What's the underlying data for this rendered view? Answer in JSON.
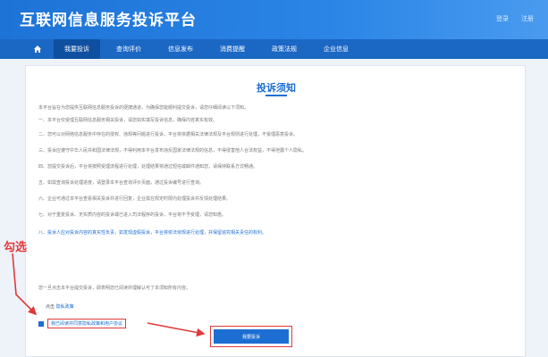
{
  "header": {
    "title": "互联网信息服务投诉平台",
    "links": [
      "登录",
      "注册"
    ]
  },
  "nav": {
    "items": [
      "我要投诉",
      "查询评价",
      "信息发布",
      "消费提醒",
      "政策法规",
      "企业信息"
    ],
    "active": 0
  },
  "notice": {
    "title": "投诉须知",
    "paragraphs": [
      "本平台旨在为您提供互联网信息服务投诉的便捷通道，为确保您能顺利提交投诉，请您仔细阅读以下须知。",
      "一、本平台仅受理互联网信息服务相关投诉，请您如实填写投诉信息，确保内容真实有效。",
      "二、您可以对网络信息服务中存在的侵权、违规等问题进行投诉，平台将依据相关法律法规及平台规则进行处理，不受理恶意投诉。",
      "三、投诉应遵守中华人民共和国法律法规，不得利用本平台发布违反国家法律法规的信息，不得侵害他人合法权益，不得泄露个人隐私。",
      "四、您提交投诉后，平台将按照受理流程进行处理，处理结果将通过短信或邮件通知您，请保持联系方式畅通。",
      "五、如需查询投诉处理进度，请登录本平台查询评价页面，通过投诉编号进行查询。",
      "六、企业可通过本平台查看相关投诉并进行回复，企业需在规定时限内处理投诉并反馈处理结果。",
      "七、对于重复投诉、无实质内容的投诉或已进入司法程序的投诉，平台将不予受理，请您知悉。"
    ],
    "highlight": "八、投诉人应对投诉内容的真实性负责，如发现虚假投诉，平台将依法依规进行处理，并保留追究相关责任的权利。",
    "closing": "您一旦点击本平台提交投诉，即表明您已阅读并理解认可了本须知所有内容。",
    "signature_prefix": "点击",
    "signature_link": "隐私政策"
  },
  "agree": {
    "text": "我已阅读并同意隐私政策和用户协议"
  },
  "submit": {
    "label": "我要投诉"
  },
  "annotation": {
    "label": "勾选"
  },
  "colors": {
    "brand": "#1c6ed2",
    "nav_bg": "#1b67c4",
    "annotation": "#e03a3a"
  }
}
